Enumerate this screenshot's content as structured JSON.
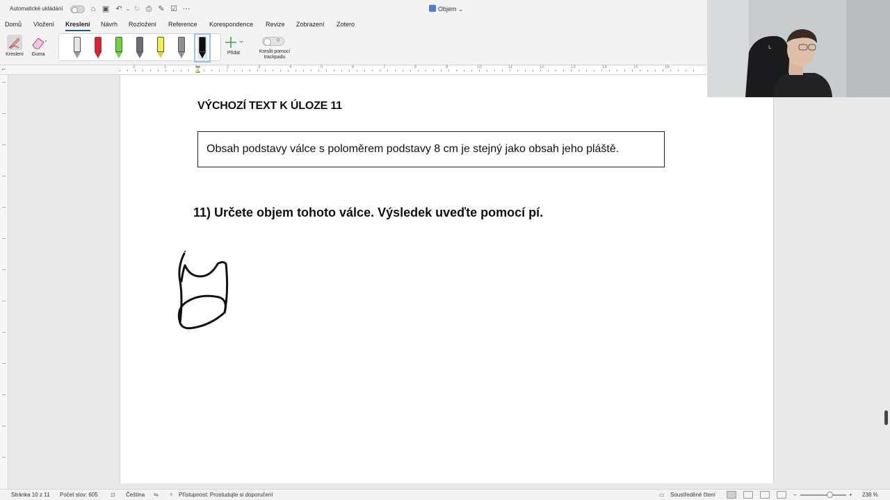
{
  "titlebar": {
    "autosave_label": "Automatické ukládání",
    "document_name": "Objem",
    "quick_access_icons": [
      "home-icon",
      "save-icon",
      "undo-icon",
      "redo-icon",
      "print-icon",
      "draw-icon",
      "customize-icon",
      "more-icon"
    ]
  },
  "tabs": [
    {
      "label": "Domů",
      "active": false
    },
    {
      "label": "Vložení",
      "active": false
    },
    {
      "label": "Kreslení",
      "active": true
    },
    {
      "label": "Návrh",
      "active": false
    },
    {
      "label": "Rozložení",
      "active": false
    },
    {
      "label": "Reference",
      "active": false
    },
    {
      "label": "Korespondence",
      "active": false
    },
    {
      "label": "Revize",
      "active": false
    },
    {
      "label": "Zobrazení",
      "active": false
    },
    {
      "label": "Zotero",
      "active": false
    }
  ],
  "ribbon": {
    "draw_label": "Kreslení",
    "eraser_label": "Guma",
    "add_label": "Přidat",
    "trackpad_label": "Kreslit pomocí trackpadu",
    "trackpad_toggle_text": "0",
    "pens": [
      {
        "name": "pen-gray",
        "color": "#cfcfcf"
      },
      {
        "name": "pen-red",
        "color": "#e0202a"
      },
      {
        "name": "pen-green",
        "color": "#6fd33a"
      },
      {
        "name": "pen-dark-gray",
        "color": "#6b6f75"
      },
      {
        "name": "highlighter-yellow",
        "color": "#f3f04a"
      },
      {
        "name": "pencil-gray",
        "color": "#8d9196"
      },
      {
        "name": "pen-black",
        "color": "#111111",
        "selected": true
      }
    ]
  },
  "ruler": {
    "numbers": [
      "2",
      "1",
      "1",
      "2",
      "3",
      "4",
      "5",
      "6",
      "7",
      "8",
      "9",
      "10",
      "11",
      "12",
      "13",
      "14",
      "15",
      "16"
    ]
  },
  "document": {
    "heading": "VÝCHOZÍ TEXT K ÚLOZE 11",
    "textbox": "Obsah podstavy válce s poloměrem podstavy 8 cm je stejný jako obsah jeho pláště.",
    "question": "11) Určete objem tohoto válce. Výsledek uveďte pomocí pí."
  },
  "statusbar": {
    "page": "Stránka 10 z 11",
    "words": "Počet slov: 605",
    "language": "Čeština",
    "accessibility": "Přístupnost: Prostudujte si doporučení",
    "focus": "Soustředěné čtení",
    "zoom": "238 %",
    "zoom_minus": "−",
    "zoom_plus": "+"
  }
}
